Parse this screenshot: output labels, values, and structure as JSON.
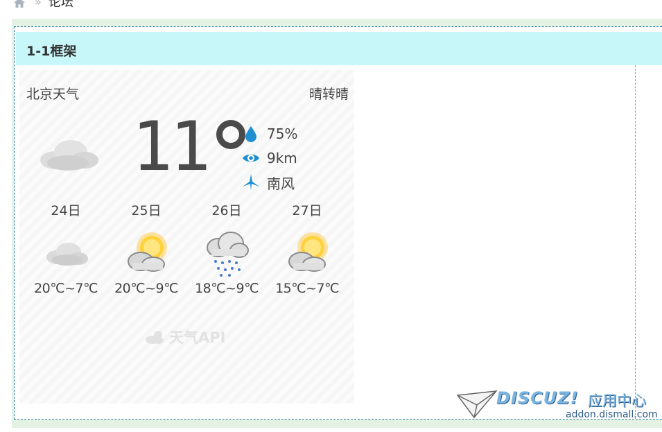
{
  "breadcrumb": {
    "separator": "»",
    "current": "论坛"
  },
  "frame": {
    "title": "1-1框架"
  },
  "weather": {
    "city": "北京天气",
    "condition": "晴转晴",
    "temperature": "11",
    "humidity": "75%",
    "visibility": "9km",
    "wind": "南风",
    "forecast": [
      {
        "day": "24日",
        "icon": "cloudy-icon",
        "range": "20℃~7℃"
      },
      {
        "day": "25日",
        "icon": "partly-sunny-icon",
        "range": "20℃~9℃"
      },
      {
        "day": "26日",
        "icon": "rain-icon",
        "range": "18℃~9℃"
      },
      {
        "day": "27日",
        "icon": "partly-sunny-icon",
        "range": "15℃~7℃"
      }
    ],
    "api_label": "天气API"
  },
  "watermark": {
    "brand": "DISCUZ!",
    "subtitle": "应用中心",
    "domain": "addon.dismall.com"
  },
  "colors": {
    "accent": "#1e8fd0",
    "title_bg": "#c8f7f9",
    "frame_bg": "#e4f2e4"
  }
}
